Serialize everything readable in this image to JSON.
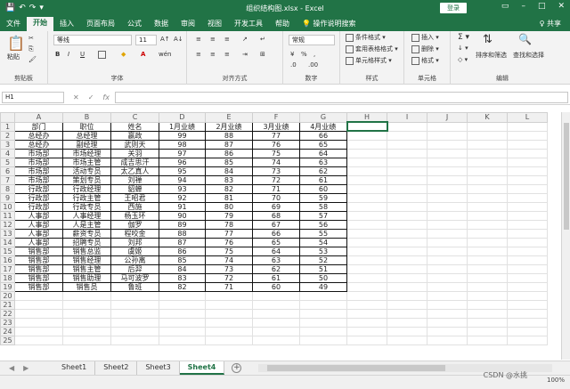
{
  "titlebar": {
    "quick_access": [
      "💾",
      "↶",
      "↷",
      "▾"
    ],
    "title": "组织结构图.xlsx  -  Excel",
    "login": "登录",
    "window_buttons": [
      "▭",
      "–",
      "□",
      "✕"
    ]
  },
  "menu": {
    "tabs": [
      "文件",
      "开始",
      "插入",
      "页面布局",
      "公式",
      "数据",
      "审阅",
      "视图",
      "开发工具",
      "帮助",
      "💡 操作说明搜索"
    ],
    "share": "♀ 共享"
  },
  "ribbon": {
    "clipboard": {
      "paste": "粘贴",
      "label": "剪贴板"
    },
    "font": {
      "name": "等线",
      "size": "11",
      "label": "字体",
      "bold": "B",
      "italic": "I",
      "underline": "U",
      "grow": "A↑",
      "shrink": "A↓",
      "color": "A",
      "fill": "◆",
      "wen": "wén"
    },
    "align": {
      "label": "对齐方式"
    },
    "number": {
      "format": "常规",
      "label": "数字",
      "pct": "%",
      "comma": ",",
      "inc": ".0",
      "dec": ".00"
    },
    "styles": {
      "items": [
        "条件格式 ▾",
        "套用表格格式 ▾",
        "单元格样式 ▾"
      ],
      "label": "样式"
    },
    "cells": {
      "items": [
        "插入 ▾",
        "删除 ▾",
        "格式 ▾"
      ],
      "label": "单元格"
    },
    "editing": {
      "sum": "Σ ▾",
      "fill": "↓ ▾",
      "clear": "◇ ▾",
      "sort": "排序和筛选",
      "find": "查找和选择",
      "label": "编辑"
    }
  },
  "formula_bar": {
    "name_box": "H1",
    "cancel": "✕",
    "enter": "✓",
    "fx": "fx",
    "value": ""
  },
  "sheet": {
    "columns": [
      "A",
      "B",
      "C",
      "D",
      "E",
      "F",
      "G",
      "H",
      "I",
      "J",
      "K",
      "L"
    ],
    "header_row": [
      "部门",
      "职位",
      "姓名",
      "1月业绩",
      "2月业绩",
      "3月业绩",
      "4月业绩"
    ],
    "rows": [
      [
        "总经办",
        "总经理",
        "嬴政",
        "99",
        "88",
        "77",
        "66"
      ],
      [
        "总经办",
        "副经理",
        "武则天",
        "98",
        "87",
        "76",
        "65"
      ],
      [
        "市场部",
        "市场经理",
        "关羽",
        "97",
        "86",
        "75",
        "64"
      ],
      [
        "市场部",
        "市场主管",
        "成吉思汗",
        "96",
        "85",
        "74",
        "63"
      ],
      [
        "市场部",
        "活动专员",
        "太乙真人",
        "95",
        "84",
        "73",
        "62"
      ],
      [
        "市场部",
        "策划专员",
        "刘禅",
        "94",
        "83",
        "72",
        "61"
      ],
      [
        "行政部",
        "行政经理",
        "貂蝉",
        "93",
        "82",
        "71",
        "60"
      ],
      [
        "行政部",
        "行政主管",
        "王昭君",
        "92",
        "81",
        "70",
        "59"
      ],
      [
        "行政部",
        "行政专员",
        "西施",
        "91",
        "80",
        "69",
        "58"
      ],
      [
        "人事部",
        "人事经理",
        "杨玉环",
        "90",
        "79",
        "68",
        "57"
      ],
      [
        "人事部",
        "人是主管",
        "伽罗",
        "89",
        "78",
        "67",
        "56"
      ],
      [
        "人事部",
        "薪资专员",
        "程咬金",
        "88",
        "77",
        "66",
        "55"
      ],
      [
        "人事部",
        "招聘专员",
        "刘邦",
        "87",
        "76",
        "65",
        "54"
      ],
      [
        "销售部",
        "销售总监",
        "虞姬",
        "86",
        "75",
        "64",
        "53"
      ],
      [
        "销售部",
        "销售经理",
        "公孙离",
        "85",
        "74",
        "63",
        "52"
      ],
      [
        "销售部",
        "销售主管",
        "后羿",
        "84",
        "73",
        "62",
        "51"
      ],
      [
        "销售部",
        "销售助理",
        "马可波罗",
        "83",
        "72",
        "61",
        "50"
      ],
      [
        "销售部",
        "销售员",
        "鲁班",
        "82",
        "71",
        "60",
        "49"
      ]
    ],
    "row_numbers": [
      "1",
      "2",
      "3",
      "4",
      "5",
      "6",
      "7",
      "8",
      "9",
      "10",
      "11",
      "12",
      "13",
      "14",
      "15",
      "16",
      "17",
      "18",
      "19",
      "20",
      "21",
      "22",
      "23",
      "24",
      "25"
    ]
  },
  "sheet_tabs": [
    "Sheet1",
    "Sheet2",
    "Sheet3",
    "Sheet4"
  ],
  "tab_nav": [
    "◀",
    "▶"
  ],
  "add_sheet": "+",
  "status": {
    "watermark": "CSDN @水挑",
    "zoom": "100%"
  },
  "colors": {
    "accent": "#217346"
  }
}
